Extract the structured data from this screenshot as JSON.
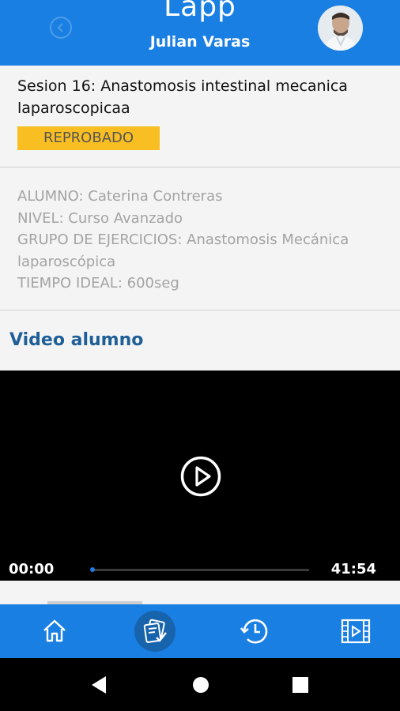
{
  "header": {
    "app_logo": "Lapp",
    "user_name": "Julian Varas",
    "back_icon": "chevron-left-icon",
    "avatar_icon": "user-avatar"
  },
  "session": {
    "title": "Sesion 16: Anastomosis intestinal mecanica laparoscopicaa",
    "status": "REPROBADO",
    "status_color": "#f9be22"
  },
  "info": {
    "student": "ALUMNO: Caterina Contreras",
    "level": "NIVEL: Curso Avanzado",
    "exercise_group": "GRUPO DE EJERCICIOS: Anastomosis Mecánica laparoscópica",
    "ideal_time": "TIEMPO IDEAL: 600seg"
  },
  "video": {
    "section_label": "Video alumno",
    "current_time": "00:00",
    "total_time": "41:54",
    "progress": 0,
    "play_icon": "play-icon"
  },
  "tabbar": {
    "items": [
      {
        "icon": "home-icon",
        "active": false
      },
      {
        "icon": "evaluations-icon",
        "active": true
      },
      {
        "icon": "history-icon",
        "active": false
      },
      {
        "icon": "video-film-icon",
        "active": false
      }
    ]
  },
  "colors": {
    "primary": "#1a7fe3",
    "title_blue": "#1f5f97",
    "muted_text": "#a3a3a3"
  }
}
